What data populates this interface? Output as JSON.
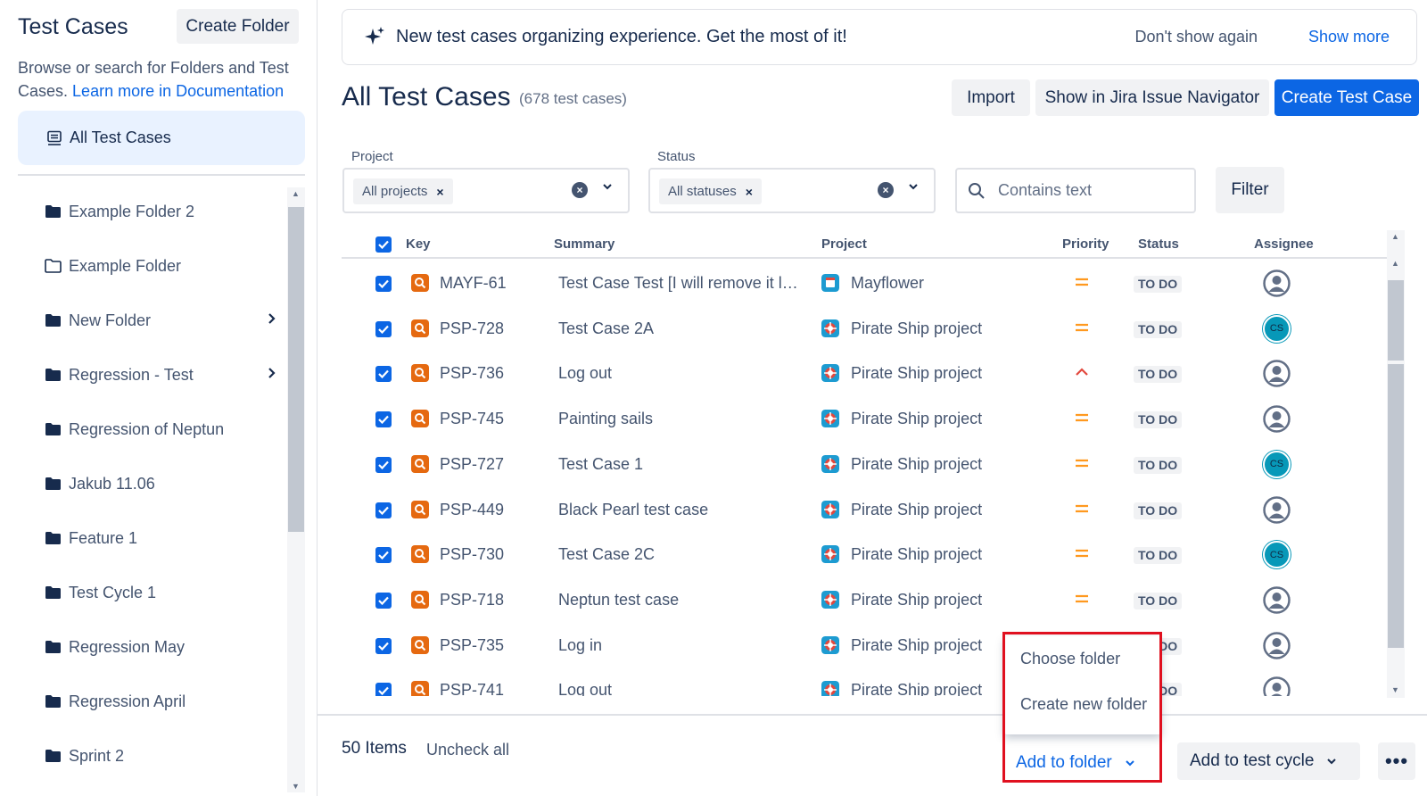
{
  "sidebar": {
    "title": "Test Cases",
    "create_folder_label": "Create Folder",
    "description": "Browse or search for Folders and Test Cases.",
    "learn_more": "Learn more in Documentation",
    "all_cases_label": "All Test Cases",
    "folders": [
      {
        "label": "Example Folder 2",
        "icon": "folder-filled-icon",
        "has_children": false
      },
      {
        "label": "Example Folder",
        "icon": "folder-outline-icon",
        "has_children": false
      },
      {
        "label": "New Folder",
        "icon": "folder-filled-icon",
        "has_children": true
      },
      {
        "label": "Regression - Test",
        "icon": "folder-filled-icon",
        "has_children": true
      },
      {
        "label": "Regression of Neptun",
        "icon": "folder-filled-icon",
        "has_children": false
      },
      {
        "label": "Jakub 11.06",
        "icon": "folder-filled-icon",
        "has_children": false
      },
      {
        "label": "Feature 1",
        "icon": "folder-filled-icon",
        "has_children": false
      },
      {
        "label": "Test Cycle 1",
        "icon": "folder-filled-icon",
        "has_children": false
      },
      {
        "label": "Regression May",
        "icon": "folder-filled-icon",
        "has_children": false
      },
      {
        "label": "Regression April",
        "icon": "folder-filled-icon",
        "has_children": false
      },
      {
        "label": "Sprint 2",
        "icon": "folder-filled-icon",
        "has_children": false
      }
    ]
  },
  "banner": {
    "message": "New test cases organizing experience. Get the most of it!",
    "dont_show": "Don't show again",
    "show_more": "Show more"
  },
  "header": {
    "title": "All Test Cases",
    "count": "(678 test cases)",
    "import_label": "Import",
    "jira_nav_label": "Show in Jira Issue Navigator",
    "create_label": "Create Test Case"
  },
  "filters": {
    "project_label": "Project",
    "project_chip": "All projects",
    "status_label": "Status",
    "status_chip": "All statuses",
    "search_placeholder": "Contains text",
    "filter_button": "Filter"
  },
  "table": {
    "columns": [
      "Key",
      "Summary",
      "Project",
      "Priority",
      "Status",
      "Assignee"
    ],
    "rows": [
      {
        "key": "MAYF-61",
        "summary": "Test Case Test [I will remove it la...",
        "project": "Mayflower",
        "priority": "medium",
        "status": "TO DO",
        "assignee": "unassigned"
      },
      {
        "key": "PSP-728",
        "summary": "Test Case 2A",
        "project": "Pirate Ship project",
        "priority": "medium",
        "status": "TO DO",
        "assignee": "CS"
      },
      {
        "key": "PSP-736",
        "summary": "Log out",
        "project": "Pirate Ship project",
        "priority": "high",
        "status": "TO DO",
        "assignee": "unassigned"
      },
      {
        "key": "PSP-745",
        "summary": "Painting sails",
        "project": "Pirate Ship project",
        "priority": "medium",
        "status": "TO DO",
        "assignee": "unassigned"
      },
      {
        "key": "PSP-727",
        "summary": "Test Case 1",
        "project": "Pirate Ship project",
        "priority": "medium",
        "status": "TO DO",
        "assignee": "CS"
      },
      {
        "key": "PSP-449",
        "summary": "Black Pearl test case",
        "project": "Pirate Ship project",
        "priority": "medium",
        "status": "TO DO",
        "assignee": "unassigned"
      },
      {
        "key": "PSP-730",
        "summary": "Test Case 2C",
        "project": "Pirate Ship project",
        "priority": "medium",
        "status": "TO DO",
        "assignee": "CS"
      },
      {
        "key": "PSP-718",
        "summary": "Neptun test case",
        "project": "Pirate Ship project",
        "priority": "medium",
        "status": "TO DO",
        "assignee": "unassigned"
      },
      {
        "key": "PSP-735",
        "summary": "Log in",
        "project": "Pirate Ship project",
        "priority": "medium",
        "status": "TO DO",
        "assignee": "unassigned"
      },
      {
        "key": "PSP-741",
        "summary": "Log out",
        "project": "Pirate Ship project",
        "priority": "medium",
        "status": "TO DO",
        "assignee": "unassigned"
      }
    ]
  },
  "footer": {
    "items_count": "50 Items",
    "uncheck_all": "Uncheck all",
    "add_to_folder": "Add to folder",
    "add_to_cycle": "Add to test cycle",
    "more": "•••"
  },
  "folder_menu": {
    "items": [
      "Choose folder",
      "Create new folder"
    ]
  },
  "colors": {
    "primary": "#0C66E4",
    "highlight": "#E0101F",
    "priority_medium": "#FF991F",
    "priority_high": "#E2483D",
    "test_type_icon": "#E56910",
    "avatar_cs": "#0798B8"
  }
}
